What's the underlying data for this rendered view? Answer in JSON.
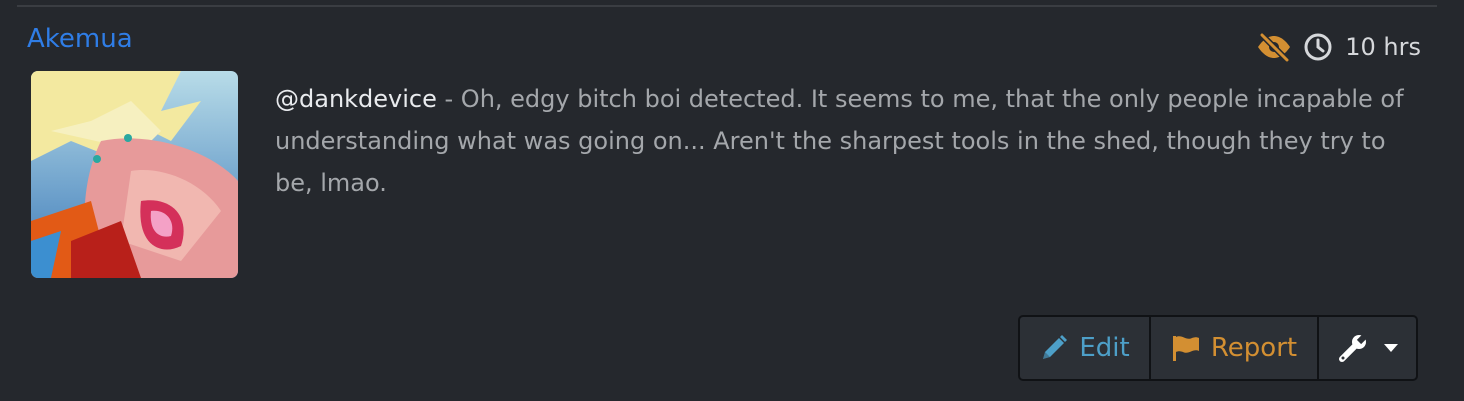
{
  "post": {
    "author": "Akemua",
    "time_ago": "10 hrs",
    "mention": "@dankdevice",
    "body": " - Oh, edgy bitch boi detected. It seems to me, that the only people incapable of understanding what was going on... Aren't the sharpest tools in the shed, though they try to be, lmao.",
    "avatar_icon": "avatar-image"
  },
  "icons": {
    "hidden": "eye-slash-icon",
    "time": "clock-icon",
    "edit": "pencil-icon",
    "report": "flag-icon",
    "tools": "wrench-icon",
    "dropdown": "caret-down-icon"
  },
  "actions": {
    "edit_label": "Edit",
    "report_label": "Report"
  },
  "colors": {
    "background": "#25282d",
    "author_link": "#2f7de6",
    "edit": "#4d9fc8",
    "report": "#d38f32",
    "hidden_icon": "#d38f32"
  }
}
